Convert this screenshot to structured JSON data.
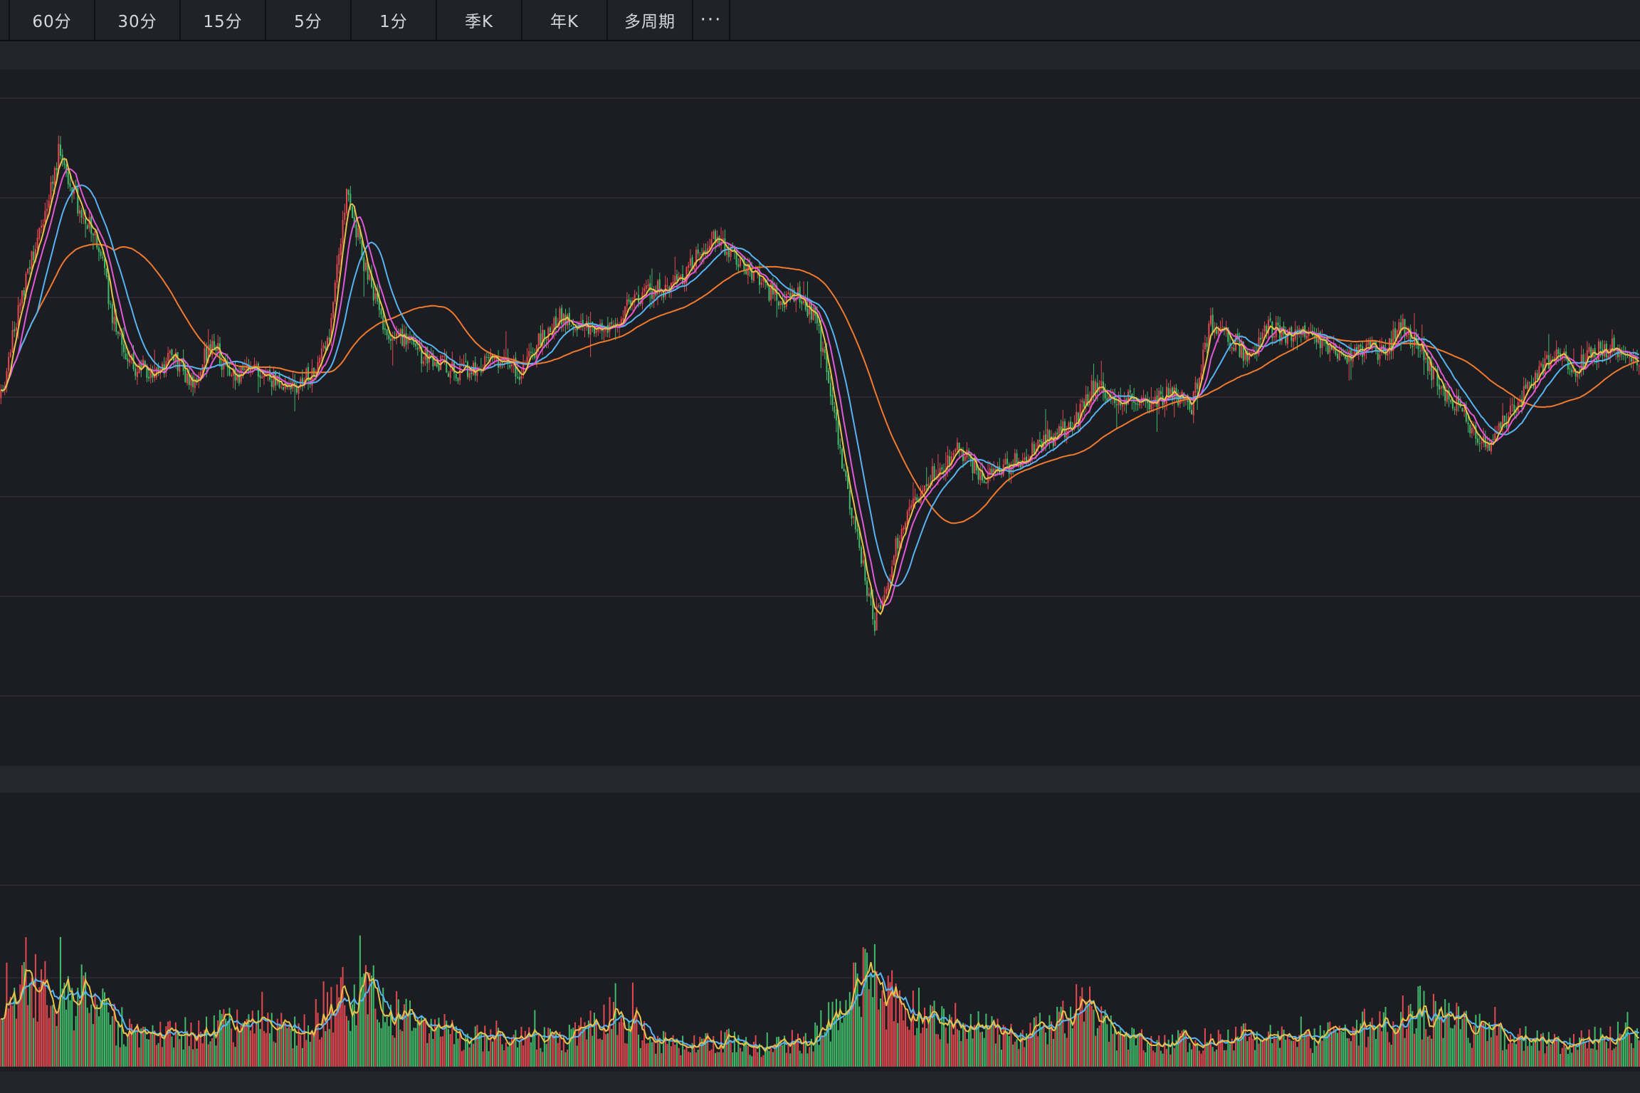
{
  "toolbar": {
    "periods": [
      {
        "label": ""
      },
      {
        "label": "60分"
      },
      {
        "label": "30分"
      },
      {
        "label": "15分"
      },
      {
        "label": "5分"
      },
      {
        "label": "1分"
      },
      {
        "label": "季K"
      },
      {
        "label": "年K"
      },
      {
        "label": "多周期"
      }
    ],
    "more_label": "···"
  },
  "colors": {
    "up": "#e0484f",
    "down": "#3fb969",
    "grid": "#2c2d33",
    "ma5": "#e8c24a",
    "ma10": "#e05ad7",
    "ma20": "#57b4f2",
    "ma60": "#f07a2e"
  },
  "chart_data": [
    {
      "type": "candlestick",
      "title": "",
      "moving_averages": [
        "ma5",
        "ma10",
        "ma20",
        "ma60"
      ],
      "grid": true,
      "trend_keypoints": [
        [
          0,
          0.47
        ],
        [
          10,
          0.66
        ],
        [
          20,
          0.79
        ],
        [
          30,
          0.95
        ],
        [
          40,
          0.85
        ],
        [
          50,
          0.78
        ],
        [
          60,
          0.6
        ],
        [
          70,
          0.53
        ],
        [
          80,
          0.52
        ],
        [
          90,
          0.55
        ],
        [
          100,
          0.5
        ],
        [
          110,
          0.58
        ],
        [
          120,
          0.51
        ],
        [
          130,
          0.52
        ],
        [
          140,
          0.51
        ],
        [
          150,
          0.49
        ],
        [
          160,
          0.51
        ],
        [
          170,
          0.57
        ],
        [
          180,
          0.88
        ],
        [
          190,
          0.72
        ],
        [
          200,
          0.6
        ],
        [
          210,
          0.59
        ],
        [
          220,
          0.55
        ],
        [
          240,
          0.52
        ],
        [
          260,
          0.55
        ],
        [
          270,
          0.52
        ],
        [
          280,
          0.58
        ],
        [
          290,
          0.63
        ],
        [
          310,
          0.6
        ],
        [
          320,
          0.62
        ],
        [
          330,
          0.67
        ],
        [
          350,
          0.69
        ],
        [
          360,
          0.73
        ],
        [
          370,
          0.79
        ],
        [
          380,
          0.76
        ],
        [
          390,
          0.72
        ],
        [
          400,
          0.68
        ],
        [
          410,
          0.66
        ],
        [
          415,
          0.68
        ],
        [
          425,
          0.62
        ],
        [
          430,
          0.52
        ],
        [
          440,
          0.3
        ],
        [
          450,
          0.12
        ],
        [
          455,
          0.03
        ],
        [
          460,
          0.1
        ],
        [
          470,
          0.23
        ],
        [
          480,
          0.3
        ],
        [
          490,
          0.34
        ],
        [
          500,
          0.37
        ],
        [
          510,
          0.32
        ],
        [
          520,
          0.33
        ],
        [
          530,
          0.35
        ],
        [
          540,
          0.38
        ],
        [
          550,
          0.4
        ],
        [
          560,
          0.43
        ],
        [
          570,
          0.5
        ],
        [
          580,
          0.46
        ],
        [
          590,
          0.47
        ],
        [
          600,
          0.46
        ],
        [
          610,
          0.48
        ],
        [
          620,
          0.45
        ],
        [
          630,
          0.62
        ],
        [
          640,
          0.59
        ],
        [
          650,
          0.55
        ],
        [
          660,
          0.61
        ],
        [
          670,
          0.59
        ],
        [
          680,
          0.6
        ],
        [
          690,
          0.57
        ],
        [
          700,
          0.55
        ],
        [
          710,
          0.57
        ],
        [
          720,
          0.56
        ],
        [
          730,
          0.61
        ],
        [
          740,
          0.56
        ],
        [
          750,
          0.49
        ],
        [
          760,
          0.45
        ],
        [
          770,
          0.39
        ],
        [
          775,
          0.37
        ],
        [
          780,
          0.41
        ],
        [
          790,
          0.46
        ],
        [
          800,
          0.52
        ],
        [
          810,
          0.55
        ],
        [
          820,
          0.53
        ],
        [
          830,
          0.56
        ],
        [
          840,
          0.57
        ],
        [
          850,
          0.54
        ],
        [
          853,
          0.53
        ]
      ],
      "candle_count": 854
    },
    {
      "type": "bar",
      "title": "",
      "series": [
        {
          "values_source": "volume"
        }
      ],
      "moving_averages": [
        "ma5",
        "ma10"
      ],
      "grid": true,
      "volume_keypoints": [
        [
          0,
          0.45
        ],
        [
          10,
          0.75
        ],
        [
          20,
          0.85
        ],
        [
          30,
          0.8
        ],
        [
          40,
          0.7
        ],
        [
          50,
          0.55
        ],
        [
          60,
          0.4
        ],
        [
          80,
          0.3
        ],
        [
          100,
          0.35
        ],
        [
          120,
          0.4
        ],
        [
          140,
          0.35
        ],
        [
          160,
          0.38
        ],
        [
          180,
          0.7
        ],
        [
          190,
          0.8
        ],
        [
          200,
          0.55
        ],
        [
          220,
          0.4
        ],
        [
          240,
          0.3
        ],
        [
          260,
          0.28
        ],
        [
          280,
          0.25
        ],
        [
          300,
          0.3
        ],
        [
          320,
          0.55
        ],
        [
          330,
          0.4
        ],
        [
          340,
          0.25
        ],
        [
          360,
          0.2
        ],
        [
          380,
          0.25
        ],
        [
          400,
          0.18
        ],
        [
          420,
          0.25
        ],
        [
          440,
          0.6
        ],
        [
          450,
          0.8
        ],
        [
          460,
          0.7
        ],
        [
          470,
          0.55
        ],
        [
          480,
          0.5
        ],
        [
          490,
          0.4
        ],
        [
          500,
          0.45
        ],
        [
          510,
          0.35
        ],
        [
          530,
          0.3
        ],
        [
          550,
          0.45
        ],
        [
          560,
          0.6
        ],
        [
          570,
          0.5
        ],
        [
          580,
          0.3
        ],
        [
          600,
          0.22
        ],
        [
          620,
          0.25
        ],
        [
          640,
          0.3
        ],
        [
          660,
          0.28
        ],
        [
          680,
          0.25
        ],
        [
          700,
          0.35
        ],
        [
          720,
          0.4
        ],
        [
          740,
          0.55
        ],
        [
          760,
          0.4
        ],
        [
          780,
          0.3
        ],
        [
          800,
          0.25
        ],
        [
          820,
          0.25
        ],
        [
          840,
          0.3
        ],
        [
          853,
          0.28
        ]
      ],
      "bar_count": 854
    }
  ]
}
